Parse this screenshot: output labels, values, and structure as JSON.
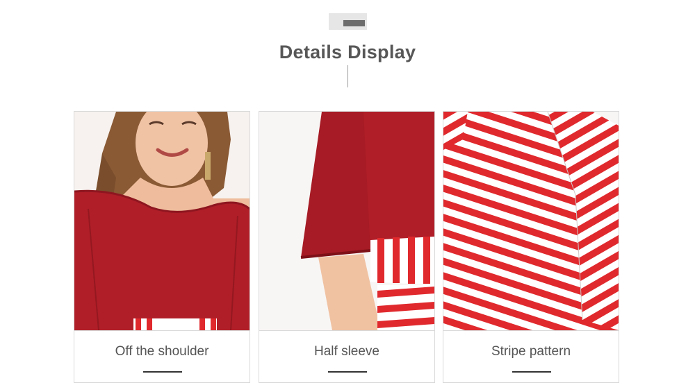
{
  "header": {
    "title": "Details Display"
  },
  "cards": [
    {
      "caption": "Off the shoulder"
    },
    {
      "caption": "Half sleeve"
    },
    {
      "caption": "Stripe pattern"
    }
  ],
  "colors": {
    "fabric_red": "#b01e28",
    "stripe_red": "#e0292d",
    "title_gray": "#575757",
    "caption_gray": "#555555"
  }
}
